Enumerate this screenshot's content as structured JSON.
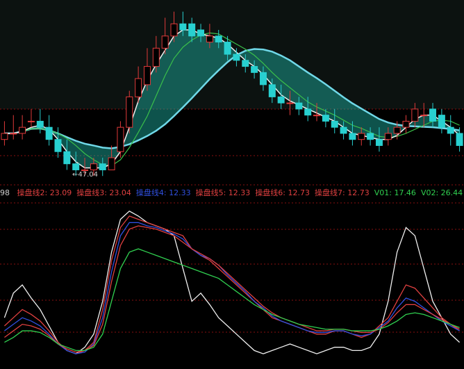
{
  "colors": {
    "background": "#000000",
    "grid": "#8a1010",
    "up": "#e03a3a",
    "down": "#28d0d0",
    "ribbon_pink": "#d9727c",
    "ribbon_teal": "#20b8a8",
    "ma_yellow": "#f0c020",
    "ma_cyan": "#70d8e8",
    "ma_green": "#3ac04a",
    "line_white": "#f0f0f0"
  },
  "chart_data": [
    {
      "type": "candlestick",
      "annotations": {
        "low_label": "47.04",
        "left_edge_value": "98"
      },
      "ohlc_open": [
        53,
        54,
        54,
        56,
        56,
        55,
        53,
        51,
        49,
        48,
        48,
        49,
        48,
        51,
        55,
        60,
        62,
        65,
        68,
        70,
        72,
        72,
        71,
        69,
        70,
        69,
        67,
        66,
        65,
        64,
        62,
        60,
        59,
        59,
        58,
        57,
        57,
        56,
        55,
        54,
        53,
        54,
        53,
        53,
        54,
        55,
        56,
        57,
        58,
        57,
        55,
        54
      ],
      "ohlc_close": [
        54,
        54,
        55,
        56,
        55,
        53,
        51,
        49,
        48,
        48,
        49,
        48,
        50,
        55,
        60,
        63,
        65,
        68,
        70,
        72,
        71,
        70,
        70,
        70,
        69,
        67,
        66,
        65,
        64,
        62,
        60,
        59,
        59,
        58,
        57,
        57,
        56,
        55,
        54,
        53,
        54,
        53,
        52,
        54,
        55,
        56,
        58,
        57,
        56,
        55,
        54,
        52
      ],
      "ohlc_high": [
        56,
        57,
        57,
        58,
        58,
        57,
        55,
        53,
        51,
        50,
        50,
        50,
        52,
        56,
        61,
        65,
        68,
        70,
        73,
        74,
        74,
        73,
        72,
        72,
        71,
        70,
        68,
        67,
        66,
        65,
        63,
        62,
        61,
        60,
        60,
        59,
        58,
        58,
        56,
        56,
        55,
        55,
        55,
        55,
        56,
        57,
        59,
        59,
        59,
        58,
        57,
        55
      ],
      "ohlc_low": [
        52,
        53,
        53,
        55,
        54,
        52,
        50,
        48,
        47,
        47.04,
        47,
        47,
        48,
        50,
        54,
        59,
        61,
        64,
        67,
        69,
        70,
        69,
        69,
        68,
        68,
        66,
        65,
        64,
        63,
        61,
        59,
        58,
        57,
        57,
        56,
        56,
        55,
        54,
        53,
        52,
        52,
        52,
        51,
        52,
        53,
        54,
        55,
        55,
        55,
        54,
        52,
        51
      ]
    },
    {
      "type": "line",
      "legend": [
        {
          "name": "操盘线2",
          "value": "23.09",
          "color": "#e04040"
        },
        {
          "name": "操盘线3",
          "value": "23.04",
          "color": "#e04040"
        },
        {
          "name": "操盘线4",
          "value": "12.33",
          "color": "#3050e0"
        },
        {
          "name": "操盘线5",
          "value": "12.33",
          "color": "#e04040"
        },
        {
          "name": "操盘线6",
          "value": "12.73",
          "color": "#e04040"
        },
        {
          "name": "操盘线7",
          "value": "12.73",
          "color": "#e04040"
        },
        {
          "name": "V01",
          "value": "17.46",
          "color": "#30d050"
        },
        {
          "name": "V02",
          "value": "26.44",
          "color": "#30d050"
        },
        {
          "name": "V03",
          "value": "",
          "color": "#30d050"
        }
      ],
      "x": [
        0,
        1,
        2,
        3,
        4,
        5,
        6,
        7,
        8,
        9,
        10,
        11,
        12,
        13,
        14,
        15,
        16,
        17,
        18,
        19,
        20,
        21,
        22,
        23,
        24,
        25,
        26,
        27,
        28,
        29,
        30,
        31,
        32,
        33,
        34,
        35,
        36,
        37,
        38,
        39,
        40,
        41,
        42,
        43,
        44,
        45,
        46,
        47,
        48,
        49,
        50,
        51
      ],
      "series": [
        {
          "name": "V02",
          "color": "#f0f0f0",
          "values": [
            30,
            45,
            50,
            42,
            35,
            25,
            15,
            10,
            8,
            12,
            20,
            40,
            70,
            90,
            95,
            92,
            88,
            86,
            84,
            80,
            60,
            40,
            45,
            38,
            30,
            25,
            20,
            15,
            10,
            8,
            10,
            12,
            14,
            12,
            10,
            8,
            10,
            12,
            12,
            10,
            10,
            12,
            20,
            40,
            70,
            85,
            80,
            60,
            40,
            30,
            20,
            15
          ]
        },
        {
          "name": "操盘线2",
          "color": "#e04040",
          "values": [
            25,
            30,
            35,
            32,
            28,
            22,
            15,
            10,
            8,
            10,
            15,
            35,
            65,
            85,
            92,
            90,
            88,
            86,
            84,
            82,
            80,
            72,
            68,
            65,
            60,
            55,
            50,
            45,
            40,
            35,
            30,
            28,
            26,
            24,
            22,
            20,
            20,
            22,
            22,
            20,
            18,
            20,
            25,
            30,
            40,
            50,
            48,
            42,
            36,
            30,
            26,
            22
          ]
        },
        {
          "name": "操盘线4",
          "color": "#3050e0",
          "values": [
            22,
            26,
            30,
            28,
            25,
            20,
            14,
            10,
            8,
            9,
            14,
            30,
            58,
            80,
            88,
            88,
            86,
            85,
            83,
            81,
            78,
            72,
            68,
            66,
            62,
            56,
            51,
            46,
            40,
            36,
            31,
            28,
            26,
            24,
            22,
            21,
            21,
            22,
            22,
            20,
            19,
            20,
            24,
            28,
            36,
            42,
            40,
            36,
            32,
            28,
            25,
            22
          ]
        },
        {
          "name": "操盘线6",
          "color": "#e04040",
          "values": [
            18,
            22,
            26,
            25,
            23,
            19,
            14,
            11,
            9,
            10,
            13,
            26,
            52,
            74,
            84,
            86,
            85,
            84,
            82,
            80,
            76,
            72,
            69,
            66,
            62,
            57,
            52,
            47,
            42,
            37,
            33,
            30,
            28,
            26,
            24,
            22,
            22,
            23,
            23,
            22,
            21,
            21,
            23,
            27,
            33,
            38,
            38,
            35,
            32,
            29,
            26,
            23
          ]
        },
        {
          "name": "V01",
          "color": "#30d050",
          "values": [
            15,
            18,
            22,
            22,
            21,
            18,
            14,
            12,
            10,
            10,
            12,
            20,
            40,
            60,
            70,
            72,
            70,
            68,
            66,
            64,
            62,
            60,
            58,
            56,
            54,
            50,
            46,
            42,
            38,
            35,
            32,
            30,
            28,
            26,
            25,
            24,
            23,
            23,
            23,
            22,
            22,
            22,
            23,
            25,
            28,
            32,
            33,
            32,
            30,
            28,
            26,
            24
          ]
        }
      ]
    }
  ]
}
